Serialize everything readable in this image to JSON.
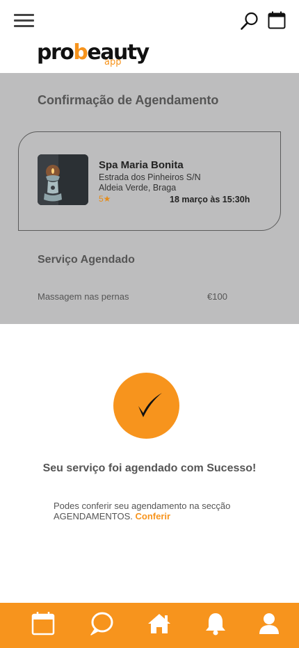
{
  "header": {
    "menu_icon": "hamburger-menu-icon",
    "search_icon": "search-icon",
    "calendar_icon": "calendar-icon",
    "logo": {
      "main_start": "pro",
      "main_accent": "b",
      "main_end": "eauty",
      "sub": "app"
    }
  },
  "confirmation": {
    "title": "Confirmação de Agendamento",
    "spa": {
      "name": "Spa Maria Bonita",
      "address_line1": "Estrada dos Pinheiros S/N",
      "address_line2": "Aldeia Verde, Braga",
      "rating": "5★",
      "date": "18 março às 15:30h"
    },
    "service_title": "Serviço Agendado",
    "service": {
      "name": "Massagem nas pernas",
      "price": "€100"
    }
  },
  "success": {
    "icon": "checkmark-icon",
    "message": "Seu serviço foi agendado com Sucesso!",
    "info": "Podes conferir seu agendamento na secção AGENDAMENTOS.",
    "link": "Conferir"
  },
  "bottom_nav": {
    "items": [
      {
        "icon": "calendar-icon"
      },
      {
        "icon": "chat-icon"
      },
      {
        "icon": "home-icon"
      },
      {
        "icon": "bell-icon"
      },
      {
        "icon": "user-icon"
      }
    ]
  },
  "colors": {
    "accent": "#f7941d",
    "grey_panel": "#bdbdbe",
    "text": "#555555"
  }
}
